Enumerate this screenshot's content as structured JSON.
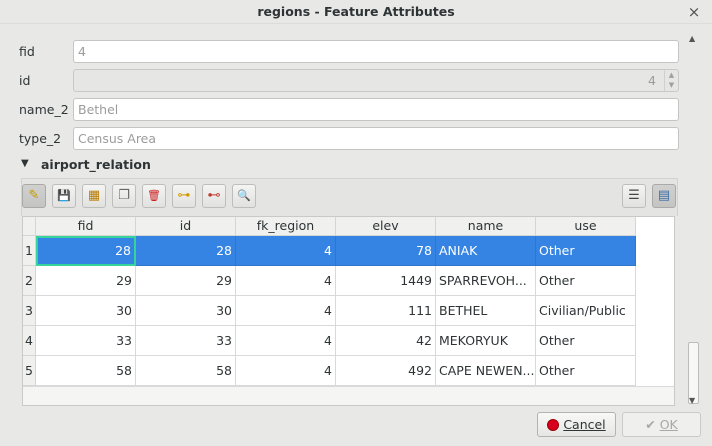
{
  "window": {
    "title": "regions - Feature Attributes",
    "close_glyph": "×"
  },
  "form": {
    "fields": [
      {
        "label": "fid",
        "value": "4"
      },
      {
        "label": "id",
        "value": "4"
      },
      {
        "label": "name_2",
        "value": "Bethel"
      },
      {
        "label": "type_2",
        "value": "Census Area"
      }
    ]
  },
  "relation": {
    "title": "airport_relation",
    "toolbar": [
      {
        "name": "toggle-editing-icon",
        "glyph": "✎"
      },
      {
        "name": "save-edits-icon",
        "glyph": "💾"
      },
      {
        "name": "add-child-feature-icon",
        "glyph": "▦"
      },
      {
        "name": "duplicate-feature-icon",
        "glyph": "❐"
      },
      {
        "name": "delete-feature-icon",
        "glyph": "🗑"
      },
      {
        "name": "link-feature-icon",
        "glyph": "⊶"
      },
      {
        "name": "unlink-feature-icon",
        "glyph": "⊷"
      },
      {
        "name": "zoom-to-feature-icon",
        "glyph": "🔍"
      },
      {
        "name": "form-view-icon",
        "glyph": "☰"
      },
      {
        "name": "table-view-icon",
        "glyph": "▤"
      }
    ],
    "table": {
      "columns": [
        "fid",
        "id",
        "fk_region",
        "elev",
        "name",
        "use"
      ],
      "rows": [
        {
          "n": "1",
          "cells": [
            "28",
            "28",
            "4",
            "78",
            "ANIAK",
            "Other"
          ]
        },
        {
          "n": "2",
          "cells": [
            "29",
            "29",
            "4",
            "1449",
            "SPARREVOH...",
            "Other"
          ]
        },
        {
          "n": "3",
          "cells": [
            "30",
            "30",
            "4",
            "111",
            "BETHEL",
            "Civilian/Public"
          ]
        },
        {
          "n": "4",
          "cells": [
            "33",
            "33",
            "4",
            "42",
            "MEKORYUK",
            "Other"
          ]
        },
        {
          "n": "5",
          "cells": [
            "58",
            "58",
            "4",
            "492",
            "CAPE NEWEN...",
            "Other"
          ]
        }
      ],
      "selected_row": 1
    }
  },
  "buttons": {
    "cancel": "Cancel",
    "ok": "OK"
  },
  "colors": {
    "selection": "#3584e4",
    "focus_border": "#36d39a",
    "cancel_icon": "#d8001e"
  }
}
